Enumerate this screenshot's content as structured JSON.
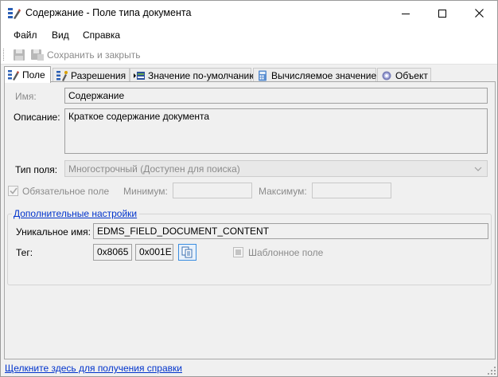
{
  "window": {
    "title": "Содержание - Поле типа документа"
  },
  "menu": {
    "items": [
      {
        "label": "Файл"
      },
      {
        "label": "Вид"
      },
      {
        "label": "Справка"
      }
    ]
  },
  "toolbar": {
    "save_close_label": "Сохранить и закрыть"
  },
  "tabs": [
    {
      "label": "Поле",
      "active": true,
      "icon": "field-edit-icon"
    },
    {
      "label": "Разрешения",
      "active": false,
      "icon": "permissions-icon"
    },
    {
      "label": "Значение по-умолчанию",
      "active": false,
      "icon": "default-value-icon"
    },
    {
      "label": "Вычисляемое значение",
      "active": false,
      "icon": "calculator-icon"
    },
    {
      "label": "Объект",
      "active": false,
      "icon": "gear-icon"
    }
  ],
  "form": {
    "name_label": "Имя:",
    "name_value": "Содержание",
    "description_label": "Описание:",
    "description_value": "Краткое содержание документа",
    "field_type_label": "Тип поля:",
    "field_type_value": "Многострочный (Доступен для поиска)",
    "required_label": "Обязательное поле",
    "required_checked": true,
    "minimum_label": "Минимум:",
    "minimum_value": "",
    "maximum_label": "Максимум:",
    "maximum_value": ""
  },
  "advanced": {
    "title": "Дополнительные настройки",
    "unique_name_label": "Уникальное имя:",
    "unique_name_value": "EDMS_FIELD_DOCUMENT_CONTENT",
    "tag_label": "Тег:",
    "tag_value_1": "0x8065",
    "tag_value_2": "0x001E",
    "template_field_label": "Шаблонное поле",
    "template_field_checked": false
  },
  "status": {
    "help_link": "Щелкните здесь для получения справки"
  },
  "colors": {
    "link": "#0033cc",
    "disabled_text": "#8b8b8b",
    "accent": "#3a8de0"
  }
}
